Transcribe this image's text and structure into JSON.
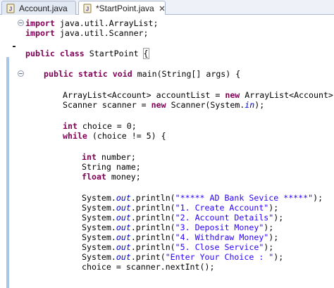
{
  "tabs": [
    {
      "label": "Account.java",
      "active": false,
      "icon": "java-file-icon"
    },
    {
      "label": "*StartPoint.java",
      "active": true,
      "icon": "java-file-icon"
    }
  ],
  "code": {
    "l1": {
      "a": "import",
      "b": " java.util.ArrayList;"
    },
    "l2": {
      "a": "import",
      "b": " java.util.Scanner;"
    },
    "l4": {
      "a": "public",
      "b": " ",
      "c": "class",
      "d": " StartPoint ",
      "e": "{"
    },
    "l6": {
      "a": "public",
      "b": " ",
      "c": "static",
      "d": " ",
      "e": "void",
      "f": " main(String[] args) {"
    },
    "l8": {
      "a": "ArrayList<Account> accountList = ",
      "b": "new",
      "c": " ArrayList<Account>();"
    },
    "l9": {
      "a": "Scanner scanner = ",
      "b": "new",
      "c": " Scanner(System.",
      "d": "in",
      "e": ");"
    },
    "l11": {
      "a": "int",
      "b": " choice = 0;"
    },
    "l12": {
      "a": "while",
      "b": " (choice != 5) {"
    },
    "l14": {
      "a": "int",
      "b": " number;"
    },
    "l15": {
      "a": "String name;"
    },
    "l16": {
      "a": "float",
      "b": " money;"
    },
    "l18": {
      "a": "System.",
      "b": "out",
      "c": ".println(",
      "d": "\"***** AD Bank Sevice *****\"",
      "e": ");"
    },
    "l19": {
      "a": "System.",
      "b": "out",
      "c": ".println(",
      "d": "\"1. Create Account\"",
      "e": ");"
    },
    "l20": {
      "a": "System.",
      "b": "out",
      "c": ".println(",
      "d": "\"2. Account Details\"",
      "e": ");"
    },
    "l21": {
      "a": "System.",
      "b": "out",
      "c": ".println(",
      "d": "\"3. Deposit Money\"",
      "e": ");"
    },
    "l22": {
      "a": "System.",
      "b": "out",
      "c": ".println(",
      "d": "\"4. Withdraw Money\"",
      "e": ");"
    },
    "l23": {
      "a": "System.",
      "b": "out",
      "c": ".println(",
      "d": "\"5. Close Service\"",
      "e": ");"
    },
    "l24": {
      "a": "System.",
      "b": "out",
      "c": ".print(",
      "d": "\"Enter Your Choice : \"",
      "e": ");"
    },
    "l25": {
      "a": "choice = scanner.nextInt();"
    }
  },
  "colors": {
    "keyword": "#7f0055",
    "field": "#0000c0",
    "string": "#2a00ff",
    "change_bar": "#a8c7e4"
  }
}
